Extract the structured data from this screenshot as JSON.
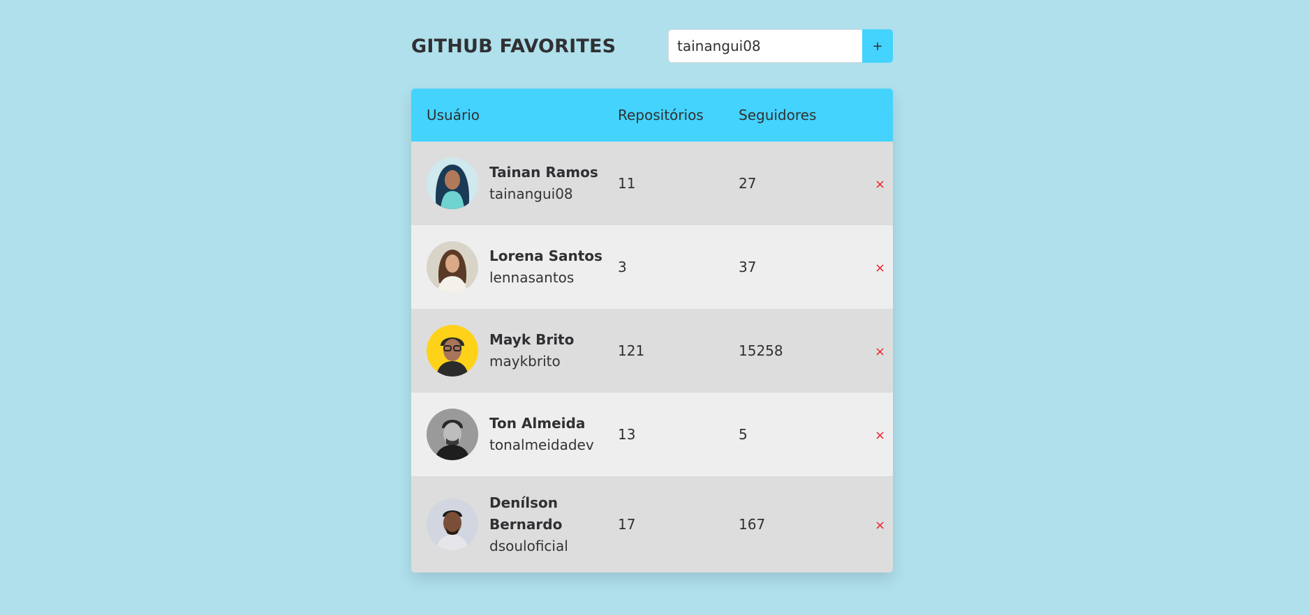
{
  "app": {
    "title": "GITHUB FAVORITES"
  },
  "search": {
    "value": "tainangui08",
    "add_label": "+"
  },
  "table": {
    "headers": {
      "user": "Usuário",
      "repos": "Repositórios",
      "followers": "Seguidores"
    },
    "rows": [
      {
        "name": "Tainan Ramos",
        "login": "tainangui08",
        "repos": "11",
        "followers": "27",
        "remove_label": "×"
      },
      {
        "name": "Lorena Santos",
        "login": "lennasantos",
        "repos": "3",
        "followers": "37",
        "remove_label": "×"
      },
      {
        "name": "Mayk Brito",
        "login": "maykbrito",
        "repos": "121",
        "followers": "15258",
        "remove_label": "×"
      },
      {
        "name": "Ton Almeida",
        "login": "tonalmeidadev",
        "repos": "13",
        "followers": "5",
        "remove_label": "×"
      },
      {
        "name": "Denílson Bernardo",
        "login": "dsouloficial",
        "repos": "17",
        "followers": "167",
        "remove_label": "×"
      }
    ]
  },
  "colors": {
    "background": "#b0e0ec",
    "accent": "#44d3fd",
    "row_odd": "#dddddd",
    "row_even": "#eeeeee",
    "remove": "#f0202a",
    "text": "#2f3033"
  }
}
